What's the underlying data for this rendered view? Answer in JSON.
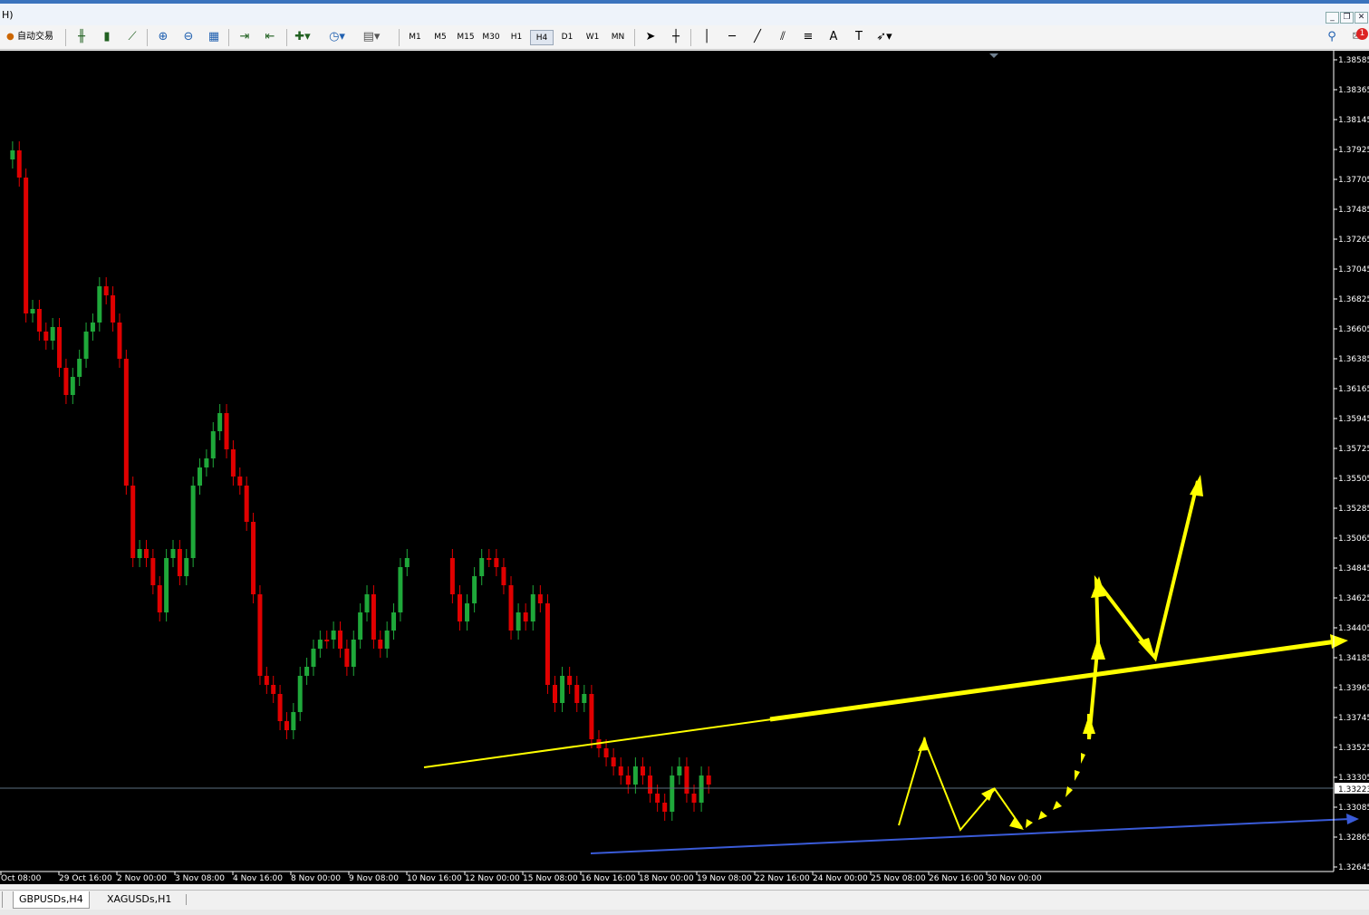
{
  "window": {
    "title": "H)",
    "min_label": "_",
    "restore_label": "❐",
    "close_label": "✕"
  },
  "toolbar": {
    "auto_trading_label": "自动交易",
    "timeframes": [
      "M1",
      "M5",
      "M15",
      "M30",
      "H1",
      "H4",
      "D1",
      "W1",
      "MN"
    ],
    "active_timeframe": "H4",
    "notification_count": "1"
  },
  "chart": {
    "symbol": "GBPUSDs",
    "timeframe": "H4",
    "current_price": "1.33223",
    "price_axis_labels": [
      "1.38585",
      "1.38365",
      "1.38145",
      "1.37925",
      "1.37705",
      "1.37485",
      "1.37265",
      "1.37045",
      "1.36825",
      "1.36605",
      "1.36385",
      "1.36165",
      "1.35945",
      "1.35725",
      "1.35505",
      "1.35285",
      "1.35065",
      "1.34845",
      "1.34625",
      "1.34405",
      "1.34185",
      "1.33965",
      "1.33745",
      "1.33525",
      "1.33305",
      "1.33085",
      "1.32865",
      "1.32645"
    ],
    "time_axis_labels": [
      "Oct 08:00",
      "29 Oct 16:00",
      "2 Nov 00:00",
      "3 Nov 08:00",
      "4 Nov 16:00",
      "8 Nov 00:00",
      "9 Nov 08:00",
      "10 Nov 16:00",
      "12 Nov 00:00",
      "15 Nov 08:00",
      "16 Nov 16:00",
      "18 Nov 00:00",
      "19 Nov 08:00",
      "22 Nov 16:00",
      "24 Nov 00:00",
      "25 Nov 08:00",
      "26 Nov 16:00",
      "30 Nov 00:00"
    ],
    "colors": {
      "background": "#000000",
      "bull": "#1fa83a",
      "bear": "#e00000",
      "annotation": "#ffff00",
      "support": "#3a5bd8"
    }
  },
  "tabs": [
    {
      "label": "GBPUSDs,H4",
      "active": true
    },
    {
      "label": "XAGUSDs,H1",
      "active": false
    }
  ]
}
